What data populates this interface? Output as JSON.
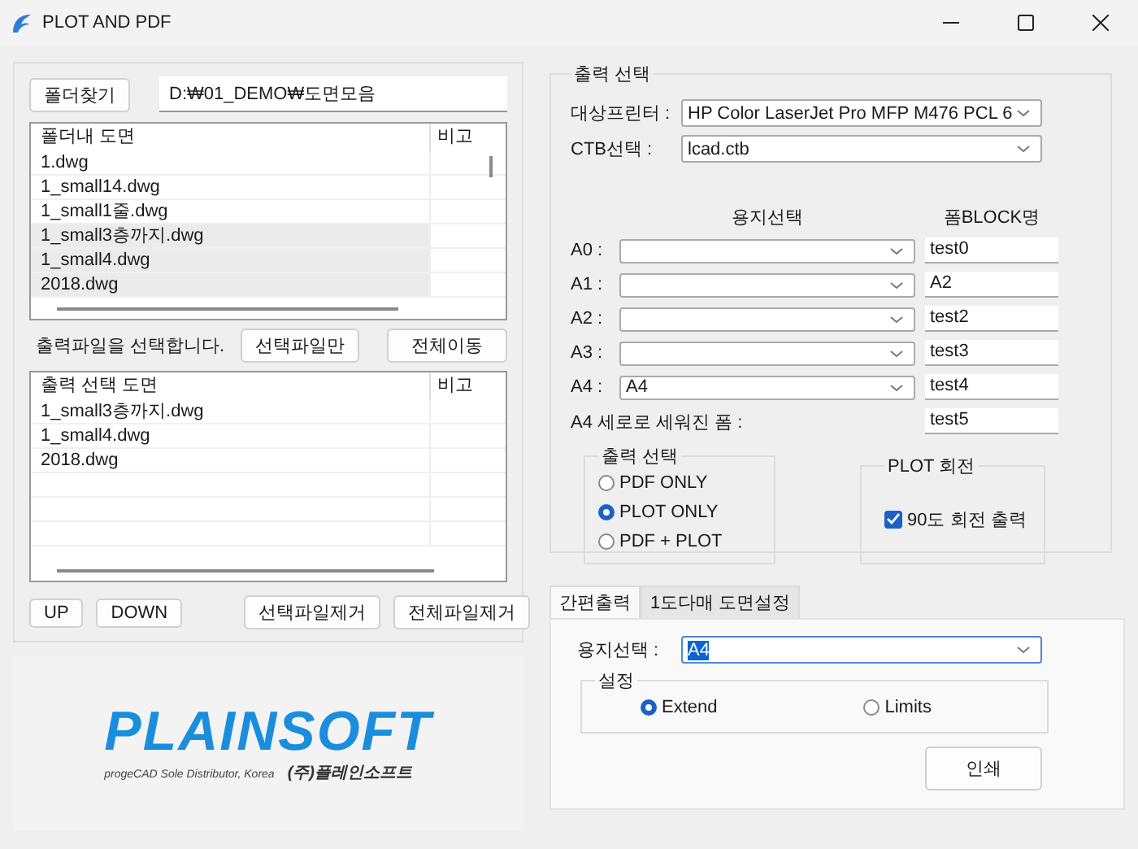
{
  "window": {
    "title": "PLOT AND PDF"
  },
  "folder": {
    "button": "폴더찾기",
    "path": "D:₩01_DEMO₩도면모음"
  },
  "file_list": {
    "columns": [
      "폴더내 도면",
      "비고"
    ],
    "rows": [
      {
        "name": "1.dwg",
        "selected": false
      },
      {
        "name": "1_small14.dwg",
        "selected": false
      },
      {
        "name": "1_small1줄.dwg",
        "selected": false
      },
      {
        "name": "1_small3층까지.dwg",
        "selected": true
      },
      {
        "name": "1_small4.dwg",
        "selected": true
      },
      {
        "name": "2018.dwg",
        "selected": true
      }
    ]
  },
  "select_hint": "출력파일을 선택합니다.",
  "move_buttons": [
    "선택파일만",
    "전체이동"
  ],
  "output_list": {
    "columns": [
      "출력 선택 도면",
      "비고"
    ],
    "rows": [
      {
        "name": "1_small3층까지.dwg"
      },
      {
        "name": "1_small4.dwg"
      },
      {
        "name": "2018.dwg"
      }
    ]
  },
  "list_buttons": [
    "UP",
    "DOWN",
    "선택파일제거",
    "전체파일제거"
  ],
  "logo": {
    "name": "PLAINSOFT",
    "tagline": "progeCAD Sole Distributor, Korea",
    "company": "(주)플레인소프트"
  },
  "output_settings": {
    "title": "출력 선택",
    "printer": {
      "label": "대상프린터 :",
      "value": "HP Color LaserJet Pro MFP M476 PCL 6"
    },
    "ctb": {
      "label": "CTB선택 :",
      "value": "lcad.ctb"
    },
    "paper_header": "용지선택",
    "block_header": "폼BLOCK명",
    "sizes": [
      {
        "label": "A0 :",
        "block": "test0"
      },
      {
        "label": "A1 :",
        "block": "A2"
      },
      {
        "label": "A2 :",
        "block": "test2"
      },
      {
        "label": "A3 :",
        "block": "test3"
      },
      {
        "label": "A4 :",
        "paper": "A4",
        "block": "test4"
      }
    ],
    "portrait": {
      "label": "A4 세로로 세워진 폼 :",
      "block": "test5"
    },
    "mode": {
      "title": "출력 선택",
      "options": [
        {
          "label": "PDF ONLY",
          "selected": false
        },
        {
          "label": "PLOT ONLY",
          "selected": true
        },
        {
          "label": "PDF + PLOT",
          "selected": false
        }
      ]
    },
    "rotation": {
      "title": "PLOT 회전",
      "label": "90도 회전 출력",
      "checked": true
    }
  },
  "tabs": [
    {
      "label": "간편출력",
      "selected": true
    },
    {
      "label": "1도다매 도면설정",
      "selected": false
    }
  ],
  "quick": {
    "paper_label": "용지선택 :",
    "paper": "A4",
    "settings_title": "설정",
    "extent": [
      {
        "label": "Extend",
        "selected": true
      },
      {
        "label": "Limits",
        "selected": false
      }
    ],
    "print_button": "인쇄"
  }
}
